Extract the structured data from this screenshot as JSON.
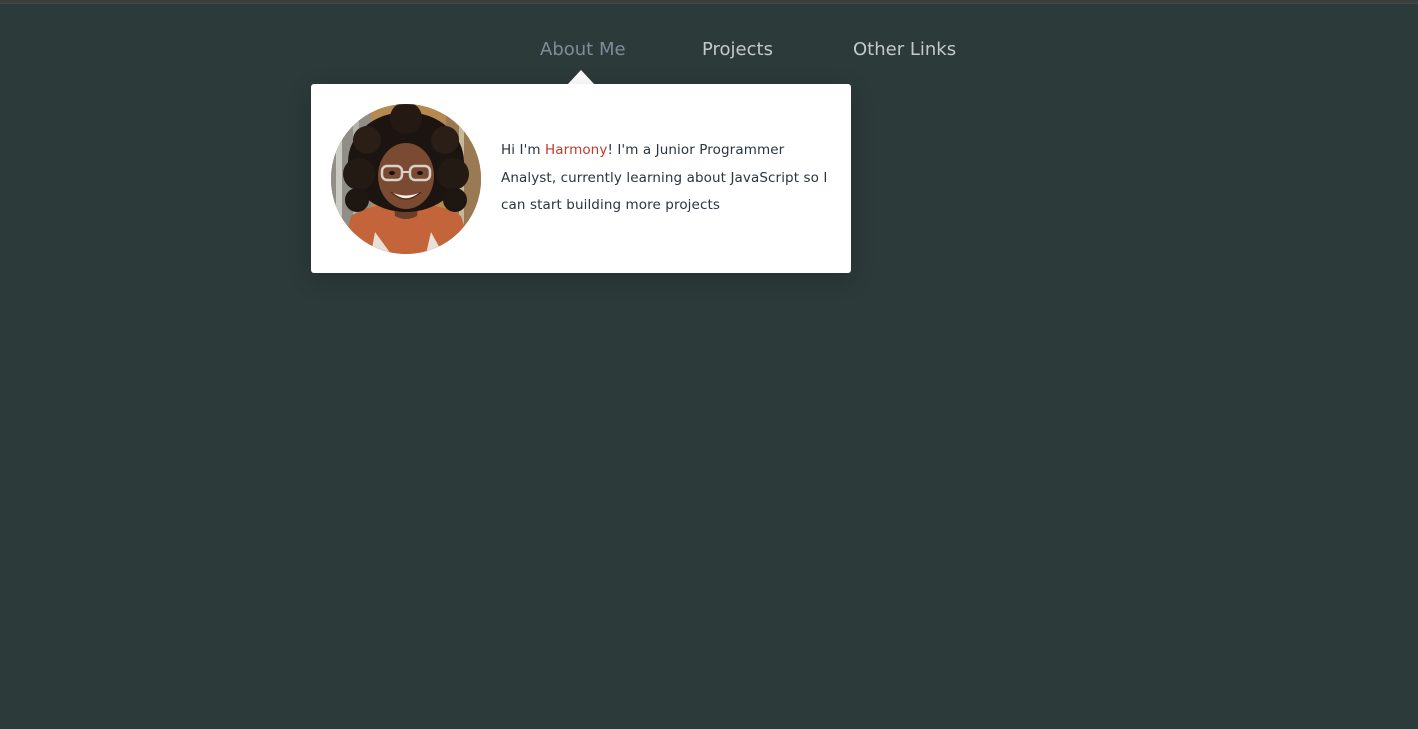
{
  "nav": {
    "items": [
      {
        "label": "About Me"
      },
      {
        "label": "Projects"
      },
      {
        "label": "Other Links"
      }
    ]
  },
  "popup": {
    "bio_prefix": "Hi I'm ",
    "name": "Harmony",
    "bio_suffix": "! I'm a Junior Programmer Analyst, currently learning about JavaScript so I can start building more projects"
  },
  "colors": {
    "background": "#2d3a3a",
    "nav_text": "#c4c9cc",
    "nav_active": "#7f8c99",
    "accent_name": "#c0392b",
    "popup_bg": "#ffffff"
  },
  "icons": {
    "avatar": "profile-photo"
  }
}
